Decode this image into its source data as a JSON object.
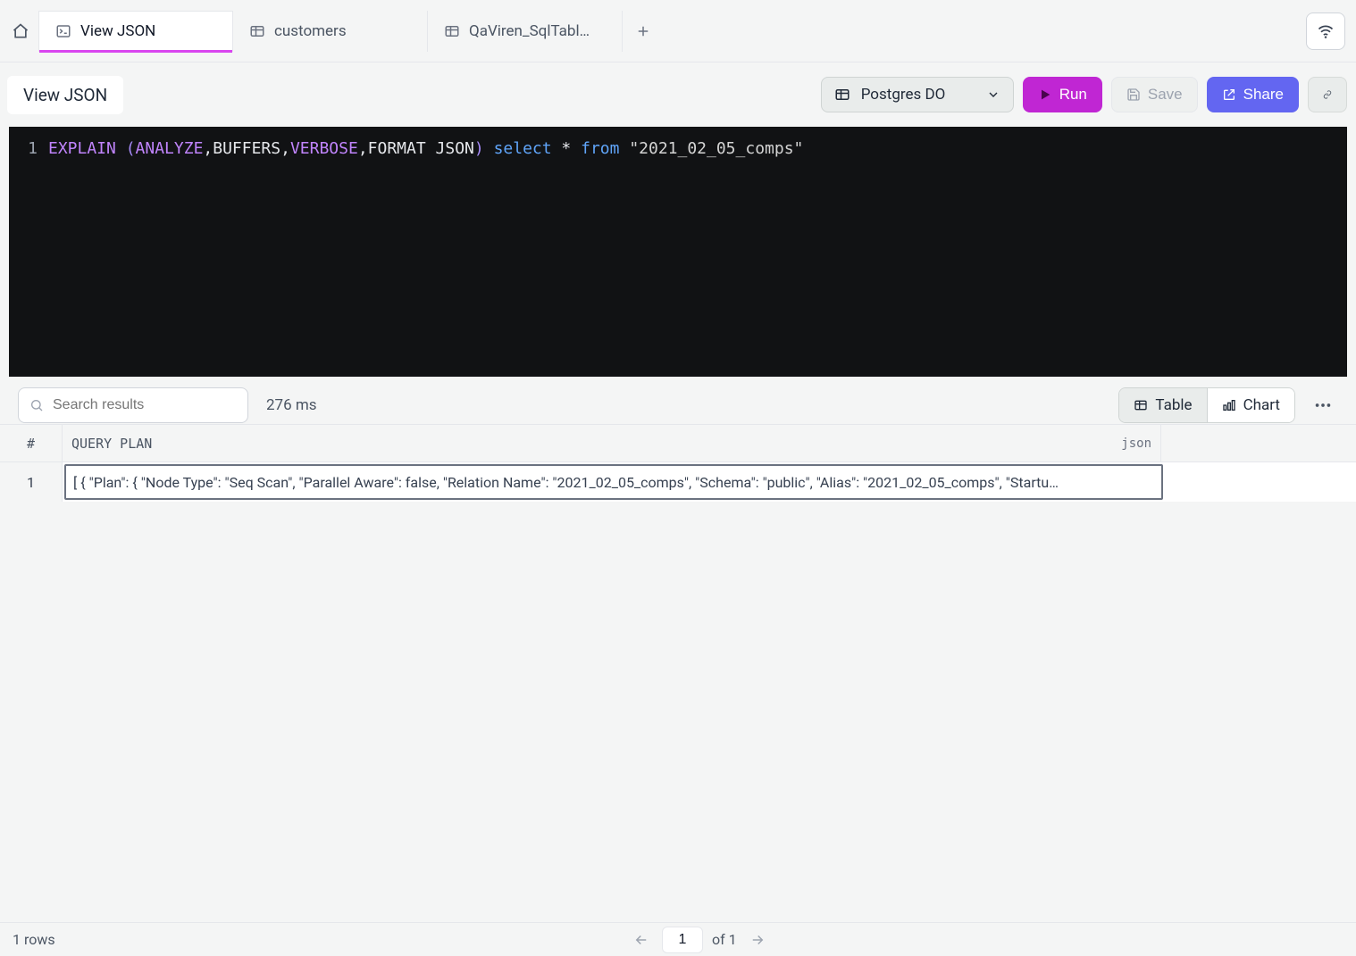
{
  "tabs": [
    {
      "label": "View JSON",
      "icon": "terminal"
    },
    {
      "label": "customers",
      "icon": "table"
    },
    {
      "label": "QaViren_SqlTabl…",
      "icon": "table"
    }
  ],
  "active_tab_index": 0,
  "title": "View JSON",
  "connection": {
    "label": "Postgres DO"
  },
  "buttons": {
    "run": "Run",
    "save": "Save",
    "share": "Share"
  },
  "editor": {
    "line_number": "1",
    "tokens": {
      "explain": "EXPLAIN",
      "lparen": " (",
      "analyze": "ANALYZE",
      "comma1": ",",
      "buffers": "BUFFERS",
      "comma2": ",",
      "verbose": "VERBOSE",
      "comma3": ",",
      "format_json": "FORMAT JSON",
      "rparen": ")",
      "space1": " ",
      "select": "select",
      "star": " * ",
      "from": "from",
      "space2": " ",
      "tablename": "\"2021_02_05_comps\""
    }
  },
  "results": {
    "search_placeholder": "Search results",
    "timing": "276 ms",
    "view_table": "Table",
    "view_chart": "Chart",
    "header_idx": "#",
    "header_col": "QUERY PLAN",
    "header_type": "json",
    "rows": [
      {
        "idx": "1",
        "value": "[ { \"Plan\": { \"Node Type\": \"Seq Scan\", \"Parallel Aware\": false, \"Relation Name\": \"2021_02_05_comps\", \"Schema\": \"public\", \"Alias\": \"2021_02_05_comps\", \"Startu…"
      }
    ]
  },
  "footer": {
    "row_count": "1 rows",
    "page_current": "1",
    "page_total": "of 1"
  }
}
